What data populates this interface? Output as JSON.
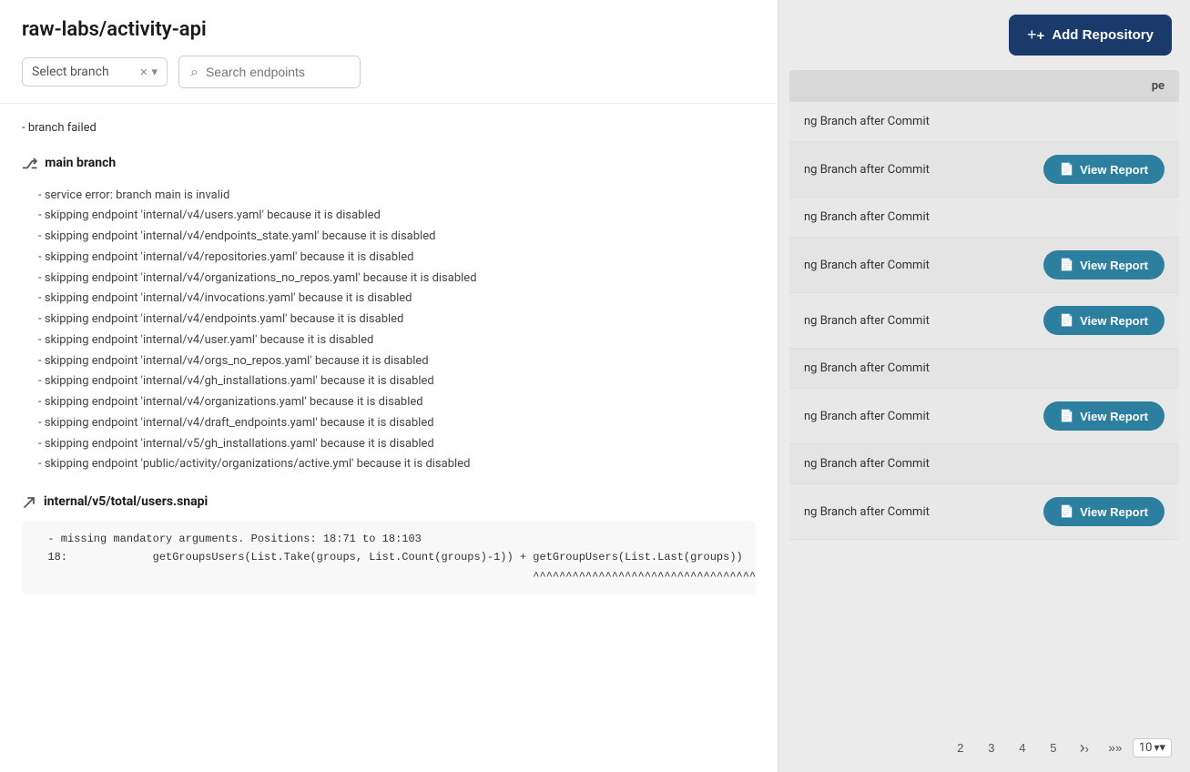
{
  "leftPanel": {
    "repoTitle": "raw-labs/activity-api",
    "branchSelector": {
      "placeholder": "Select branch",
      "value": ""
    },
    "searchPlaceholder": "Search endpoints",
    "logLines": [
      "- branch failed",
      "⎇ main branch",
      "  - service error: branch main is invalid",
      "  - skipping endpoint 'internal/v4/users.yaml' because it is disabled",
      "  - skipping endpoint 'internal/v4/endpoints_state.yaml' because it is disabled",
      "  - skipping endpoint 'internal/v4/repositories.yaml' because it is disabled",
      "  - skipping endpoint 'internal/v4/organizations_no_repos.yaml' because it is disabled",
      "  - skipping endpoint 'internal/v4/invocations.yaml' because it is disabled",
      "  - skipping endpoint 'internal/v4/endpoints.yaml' because it is disabled",
      "  - skipping endpoint 'internal/v4/user.yaml' because it is disabled",
      "  - skipping endpoint 'internal/v4/orgs_no_repos.yaml' because it is disabled",
      "  - skipping endpoint 'internal/v4/gh_installations.yaml' because it is disabled",
      "  - skipping endpoint 'internal/v4/organizations.yaml' because it is disabled",
      "  - skipping endpoint 'internal/v4/draft_endpoints.yaml' because it is disabled",
      "  - skipping endpoint 'internal/v5/gh_installations.yaml' because it is disabled",
      "  - skipping endpoint 'public/activity/organizations/active.yml' because it is disabled"
    ],
    "mainBranchLabel": "main branch",
    "endpointSection": {
      "icon": "endpoint",
      "name": "internal/v5/total/users.snapi",
      "errorLine1": "  - missing mandatory arguments. Positions: 18:71 to 18:103",
      "errorLine2": "  18:             getGroupsUsers(List.Take(groups, List.Count(groups)-1)) + getGroupUsers(List.Last(groups))",
      "errorLine3": "                                                                           ^^^^^^^^^^^^^^^^^^^^^^^^^^^^^^^^^^^^"
    }
  },
  "rightPanel": {
    "addRepoLabel": "+ Add Repository",
    "tableHeader": {
      "typeLabel": "pe"
    },
    "tableRows": [
      {
        "type": "ng Branch after Commit",
        "hasButton": false
      },
      {
        "type": "ng Branch after Commit",
        "hasButton": true
      },
      {
        "type": "ng Branch after Commit",
        "hasButton": false
      },
      {
        "type": "ng Branch after Commit",
        "hasButton": true
      },
      {
        "type": "ng Branch after Commit",
        "hasButton": true
      },
      {
        "type": "ng Branch after Commit",
        "hasButton": false
      },
      {
        "type": "ng Branch after Commit",
        "hasButton": true
      },
      {
        "type": "ng Branch after Commit",
        "hasButton": false
      },
      {
        "type": "ng Branch after Commit",
        "hasButton": true
      }
    ],
    "viewReportLabel": "View Report",
    "pagination": {
      "pages": [
        "2",
        "3",
        "4",
        "5"
      ],
      "perPage": "10"
    }
  }
}
